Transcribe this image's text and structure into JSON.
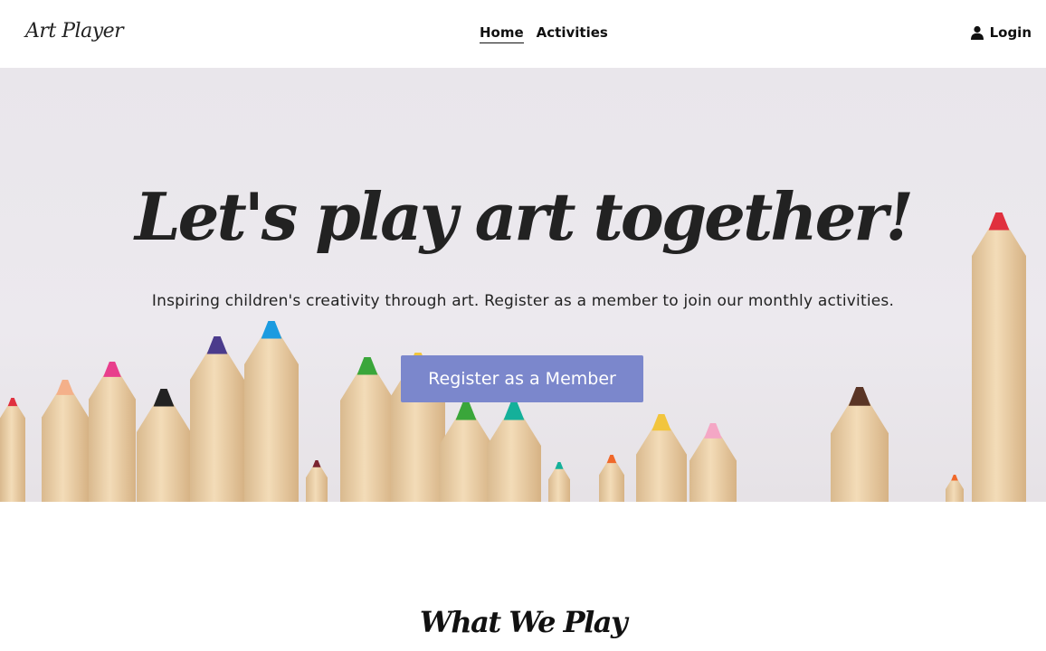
{
  "header": {
    "logo": "Art Player",
    "nav": [
      {
        "label": "Home",
        "active": true
      },
      {
        "label": "Activities",
        "active": false
      }
    ],
    "login_label": "Login",
    "login_icon": "user-icon"
  },
  "hero": {
    "title": "Let's play art together!",
    "subtitle": "Inspiring children's creativity through art. Register as a member to join our monthly activities.",
    "cta_label": "Register as a Member",
    "cta_color": "#7b87cc",
    "background": "colored-pencils"
  },
  "section": {
    "title": "What We Play"
  }
}
